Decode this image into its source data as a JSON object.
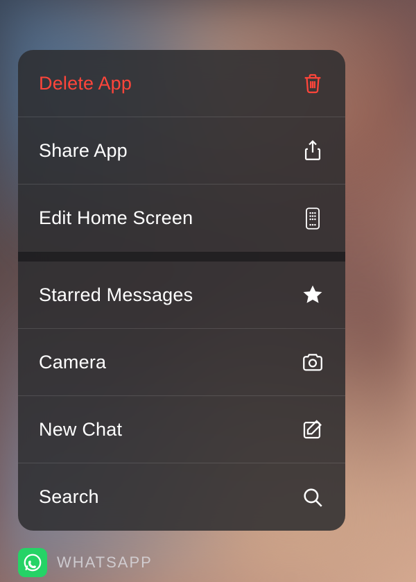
{
  "menu": {
    "delete_app": {
      "label": "Delete App",
      "destructive": true
    },
    "share_app": {
      "label": "Share App"
    },
    "edit_home_screen": {
      "label": "Edit Home Screen"
    },
    "starred_messages": {
      "label": "Starred Messages"
    },
    "camera": {
      "label": "Camera"
    },
    "new_chat": {
      "label": "New Chat"
    },
    "search": {
      "label": "Search"
    }
  },
  "app": {
    "name": "WHATSAPP"
  }
}
